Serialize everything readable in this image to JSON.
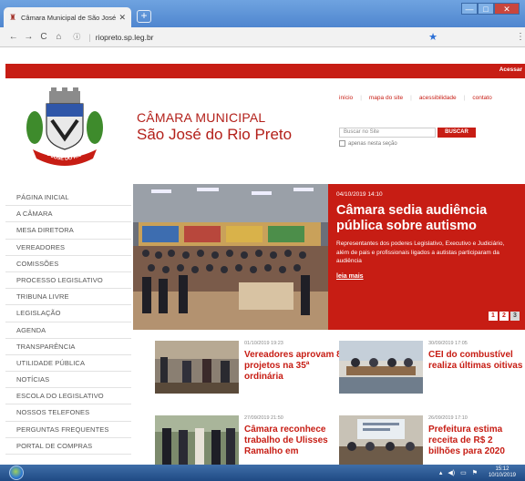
{
  "browser": {
    "tab_title": "Câmara Municipal de São José d",
    "tab_close": "✕",
    "new_tab": "+",
    "url": "riopreto.sp.leg.br",
    "nav": {
      "back": "←",
      "forward": "→",
      "reload": "C",
      "home": "⌂"
    },
    "window": {
      "minimize": "—",
      "maximize": "□",
      "close": "✕"
    }
  },
  "site": {
    "top_bar": {
      "login": "Acessar"
    },
    "brand": {
      "line1": "CÂMARA MUNICIPAL",
      "line2": "São José do Rio Preto",
      "seal_text": "SÃO JOSÉ DO RIO PRETO"
    },
    "top_links": [
      "início",
      "mapa do site",
      "acessibilidade",
      "contato"
    ],
    "search": {
      "placeholder": "Buscar no Site",
      "button": "BUSCAR",
      "checkbox_label": "apenas nesta seção"
    },
    "menu": [
      "PÁGINA INICIAL",
      "A CÂMARA",
      "MESA DIRETORA",
      "VEREADORES",
      "COMISSÕES",
      "PROCESSO LEGISLATIVO",
      "TRIBUNA LIVRE",
      "LEGISLAÇÃO",
      "AGENDA",
      "TRANSPARÊNCIA",
      "UTILIDADE PÚBLICA",
      "NOTÍCIAS",
      "ESCOLA DO LEGISLATIVO",
      "NOSSOS TELEFONES",
      "PERGUNTAS FREQUENTES",
      "PORTAL DE COMPRAS"
    ],
    "hero": {
      "date": "04/10/2019 14:10",
      "title": "Câmara sedia audiência pública sobre autismo",
      "description": "Representantes dos poderes Legislativo, Executivo e Judiciário, além de pais e profissionais ligados a autistas participaram da audiência",
      "more": "leia mais",
      "pages": [
        "1",
        "2",
        "3"
      ]
    },
    "news": [
      {
        "date": "01/10/2019 19:23",
        "title": "Vereadores aprovam 8 projetos na 35ª ordinária"
      },
      {
        "date": "30/09/2019 17:05",
        "title": "CEI do combustível realiza últimas oitivas"
      },
      {
        "date": "27/09/2019 21:50",
        "title": "Câmara reconhece trabalho de Ulisses Ramalho em"
      },
      {
        "date": "26/09/2019 17:10",
        "title": "Prefeitura estima receita de R$ 2 bilhões para 2020"
      }
    ]
  },
  "taskbar": {
    "time": "15:12",
    "date": "10/10/2019"
  },
  "colors": {
    "brand_red": "#c71d14",
    "title_red": "#b3201a"
  }
}
